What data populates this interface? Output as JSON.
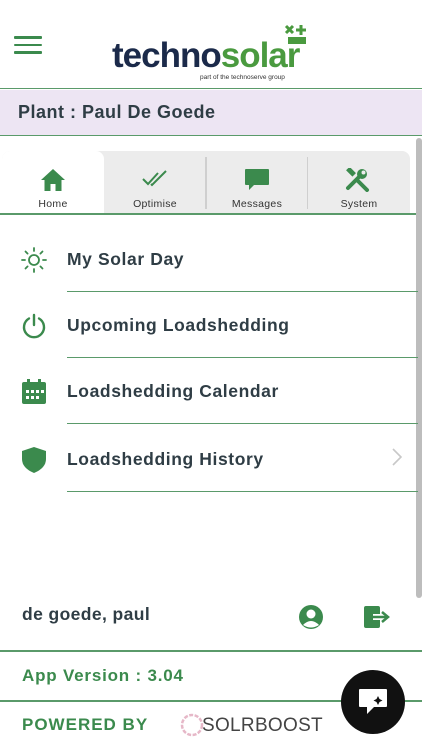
{
  "header": {
    "brand_part1": "techno",
    "brand_part2": "solar",
    "brand_sub": "part of the technoserve group"
  },
  "plant": {
    "label": "Plant : Paul De Goede"
  },
  "tabs": [
    {
      "label": "Home",
      "icon": "home-icon",
      "active": true
    },
    {
      "label": "Optimise",
      "icon": "double-check-icon"
    },
    {
      "label": "Messages",
      "icon": "message-icon"
    },
    {
      "label": "System",
      "icon": "tools-icon"
    }
  ],
  "menu": [
    {
      "label": "My Solar Day",
      "icon": "sun-icon"
    },
    {
      "label": "Upcoming Loadshedding",
      "icon": "power-icon"
    },
    {
      "label": "Loadshedding Calendar",
      "icon": "calendar-icon"
    },
    {
      "label": "Loadshedding History",
      "icon": "shield-icon"
    }
  ],
  "footer": {
    "user_name": "de goede, paul",
    "app_version": "App Version : 3.04",
    "powered_by": "POWERED BY",
    "powered_brand": "SOLRBOOST"
  },
  "colors": {
    "accent_green": "#3b8a4d",
    "brand_navy": "#1b2a4a",
    "plant_bar_bg": "#ede5f3",
    "divider": "#5a9a6a"
  }
}
